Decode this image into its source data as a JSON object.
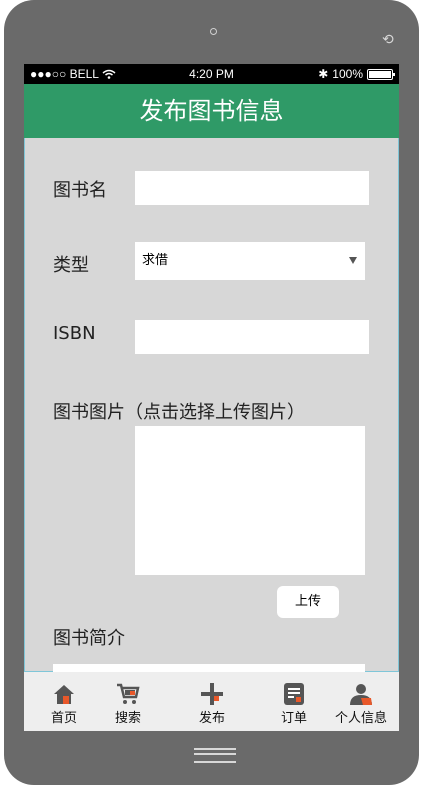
{
  "status_bar": {
    "signal": "●●●○○",
    "carrier": "BELL",
    "time": "4:20 PM",
    "bluetooth": "✱",
    "battery": "100%"
  },
  "header": {
    "title": "发布图书信息"
  },
  "form": {
    "book_name_label": "图书名",
    "book_name_value": "",
    "type_label": "类型",
    "type_selected": "求借",
    "isbn_label": "ISBN",
    "isbn_value": "",
    "image_label": "图书图片（点击选择上传图片）",
    "upload_label": "上传",
    "intro_label": "图书简介"
  },
  "tabbar": [
    {
      "label": "首页",
      "icon": "home-icon"
    },
    {
      "label": "搜索",
      "icon": "cart-icon"
    },
    {
      "label": "发布",
      "icon": "plus-icon"
    },
    {
      "label": "订单",
      "icon": "order-icon"
    },
    {
      "label": "个人信息",
      "icon": "user-icon"
    }
  ],
  "colors": {
    "header": "#2f9a67",
    "accent": "#e8582a",
    "background": "#d7d7d7",
    "device": "#6a6a6a"
  }
}
